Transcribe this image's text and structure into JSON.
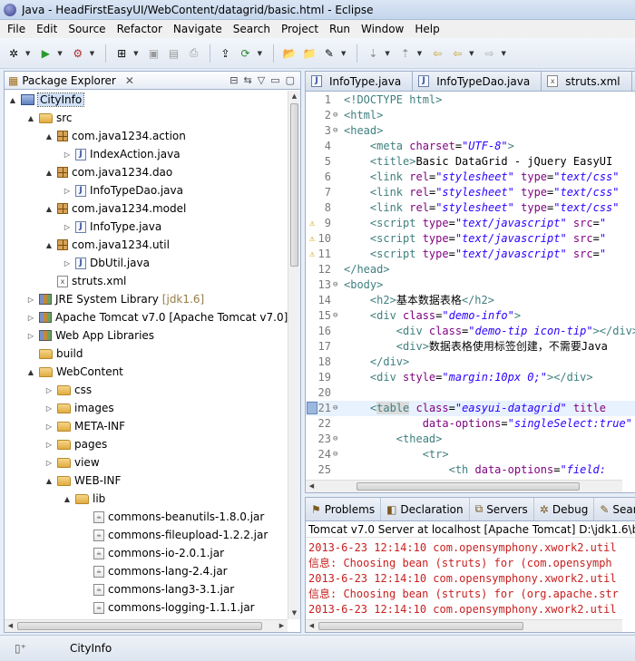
{
  "window": {
    "title": "Java - HeadFirstEasyUI/WebContent/datagrid/basic.html - Eclipse"
  },
  "menu": [
    "File",
    "Edit",
    "Source",
    "Refactor",
    "Navigate",
    "Search",
    "Project",
    "Run",
    "Window",
    "Help"
  ],
  "explorer": {
    "tab_label": "Package Explorer",
    "tree": [
      {
        "label": "CityInfo",
        "icon": "project",
        "twisty": "▲"
      },
      {
        "label": "src",
        "icon": "folder",
        "twisty": "▲"
      },
      {
        "label": "com.java1234.action",
        "icon": "pkg",
        "twisty": "▲"
      },
      {
        "label": "IndexAction.java",
        "icon": "java",
        "twisty": "▷"
      },
      {
        "label": "com.java1234.dao",
        "icon": "pkg",
        "twisty": "▲"
      },
      {
        "label": "InfoTypeDao.java",
        "icon": "java",
        "twisty": "▷"
      },
      {
        "label": "com.java1234.model",
        "icon": "pkg",
        "twisty": "▲"
      },
      {
        "label": "InfoType.java",
        "icon": "java",
        "twisty": "▷"
      },
      {
        "label": "com.java1234.util",
        "icon": "pkg",
        "twisty": "▲"
      },
      {
        "label": "DbUtil.java",
        "icon": "java",
        "twisty": "▷"
      },
      {
        "label": "struts.xml",
        "icon": "xml",
        "twisty": ""
      },
      {
        "label": "JRE System Library",
        "suffix": "[jdk1.6]",
        "icon": "lib",
        "twisty": "▷"
      },
      {
        "label": "Apache Tomcat v7.0 [Apache Tomcat v7.0]",
        "icon": "lib",
        "twisty": "▷"
      },
      {
        "label": "Web App Libraries",
        "icon": "lib",
        "twisty": "▷"
      },
      {
        "label": "build",
        "icon": "folder",
        "twisty": ""
      },
      {
        "label": "WebContent",
        "icon": "folder",
        "twisty": "▲"
      },
      {
        "label": "css",
        "icon": "folder",
        "twisty": "▷"
      },
      {
        "label": "images",
        "icon": "folder",
        "twisty": "▷"
      },
      {
        "label": "META-INF",
        "icon": "folder",
        "twisty": "▷"
      },
      {
        "label": "pages",
        "icon": "folder",
        "twisty": "▷"
      },
      {
        "label": "view",
        "icon": "folder",
        "twisty": "▷"
      },
      {
        "label": "WEB-INF",
        "icon": "folder",
        "twisty": "▲"
      },
      {
        "label": "lib",
        "icon": "folder",
        "twisty": "▲"
      },
      {
        "label": "commons-beanutils-1.8.0.jar",
        "icon": "jar",
        "twisty": ""
      },
      {
        "label": "commons-fileupload-1.2.2.jar",
        "icon": "jar",
        "twisty": ""
      },
      {
        "label": "commons-io-2.0.1.jar",
        "icon": "jar",
        "twisty": ""
      },
      {
        "label": "commons-lang-2.4.jar",
        "icon": "jar",
        "twisty": ""
      },
      {
        "label": "commons-lang3-3.1.jar",
        "icon": "jar",
        "twisty": ""
      },
      {
        "label": "commons-logging-1.1.1.jar",
        "icon": "jar",
        "twisty": ""
      }
    ]
  },
  "editor": {
    "tabs": [
      {
        "label": "InfoType.java",
        "icon": "J"
      },
      {
        "label": "InfoTypeDao.java",
        "icon": "J"
      },
      {
        "label": "struts.xml",
        "icon": "x"
      }
    ],
    "lines": [
      {
        "n": "1",
        "fold": "",
        "warn": false,
        "parts": [
          [
            "tag",
            "<!DOCTYPE html>"
          ]
        ]
      },
      {
        "n": "2",
        "fold": "⊖",
        "warn": false,
        "parts": [
          [
            "tag",
            "<html>"
          ]
        ]
      },
      {
        "n": "3",
        "fold": "⊖",
        "warn": false,
        "parts": [
          [
            "tag",
            "<head>"
          ]
        ]
      },
      {
        "n": "4",
        "fold": "",
        "warn": false,
        "parts": [
          [
            "txt",
            "    "
          ],
          [
            "tag",
            "<meta "
          ],
          [
            "attr",
            "charset"
          ],
          [
            "txt",
            "="
          ],
          [
            "str",
            "\"UTF-8\""
          ],
          [
            "tag",
            ">"
          ]
        ]
      },
      {
        "n": "5",
        "fold": "",
        "warn": false,
        "parts": [
          [
            "txt",
            "    "
          ],
          [
            "tag",
            "<title>"
          ],
          [
            "txt",
            "Basic DataGrid - jQuery EasyUI"
          ]
        ]
      },
      {
        "n": "6",
        "fold": "",
        "warn": false,
        "parts": [
          [
            "txt",
            "    "
          ],
          [
            "tag",
            "<link "
          ],
          [
            "attr",
            "rel"
          ],
          [
            "txt",
            "="
          ],
          [
            "str",
            "\"stylesheet\""
          ],
          [
            "attr",
            " type"
          ],
          [
            "txt",
            "="
          ],
          [
            "str",
            "\"text/css\""
          ]
        ]
      },
      {
        "n": "7",
        "fold": "",
        "warn": false,
        "parts": [
          [
            "txt",
            "    "
          ],
          [
            "tag",
            "<link "
          ],
          [
            "attr",
            "rel"
          ],
          [
            "txt",
            "="
          ],
          [
            "str",
            "\"stylesheet\""
          ],
          [
            "attr",
            " type"
          ],
          [
            "txt",
            "="
          ],
          [
            "str",
            "\"text/css\""
          ]
        ]
      },
      {
        "n": "8",
        "fold": "",
        "warn": false,
        "parts": [
          [
            "txt",
            "    "
          ],
          [
            "tag",
            "<link "
          ],
          [
            "attr",
            "rel"
          ],
          [
            "txt",
            "="
          ],
          [
            "str",
            "\"stylesheet\""
          ],
          [
            "attr",
            " type"
          ],
          [
            "txt",
            "="
          ],
          [
            "str",
            "\"text/css\""
          ]
        ]
      },
      {
        "n": "9",
        "fold": "",
        "warn": true,
        "parts": [
          [
            "txt",
            "    "
          ],
          [
            "tag",
            "<script "
          ],
          [
            "attr",
            "type"
          ],
          [
            "txt",
            "="
          ],
          [
            "str",
            "\"text/javascript\""
          ],
          [
            "attr",
            " src"
          ],
          [
            "txt",
            "="
          ],
          [
            "str",
            "\""
          ]
        ]
      },
      {
        "n": "10",
        "fold": "",
        "warn": true,
        "parts": [
          [
            "txt",
            "    "
          ],
          [
            "tag",
            "<script "
          ],
          [
            "attr",
            "type"
          ],
          [
            "txt",
            "="
          ],
          [
            "str",
            "\"text/javascript\""
          ],
          [
            "attr",
            " src"
          ],
          [
            "txt",
            "="
          ],
          [
            "str",
            "\""
          ]
        ]
      },
      {
        "n": "11",
        "fold": "",
        "warn": true,
        "parts": [
          [
            "txt",
            "    "
          ],
          [
            "tag",
            "<script "
          ],
          [
            "attr",
            "type"
          ],
          [
            "txt",
            "="
          ],
          [
            "str",
            "\"text/javascript\""
          ],
          [
            "attr",
            " src"
          ],
          [
            "txt",
            "="
          ],
          [
            "str",
            "\""
          ]
        ]
      },
      {
        "n": "12",
        "fold": "",
        "warn": false,
        "parts": [
          [
            "tag",
            "</head>"
          ]
        ]
      },
      {
        "n": "13",
        "fold": "⊖",
        "warn": false,
        "parts": [
          [
            "tag",
            "<body>"
          ]
        ]
      },
      {
        "n": "14",
        "fold": "",
        "warn": false,
        "parts": [
          [
            "txt",
            "    "
          ],
          [
            "tag",
            "<h2>"
          ],
          [
            "txt",
            "基本数据表格"
          ],
          [
            "tag",
            "</h2>"
          ]
        ]
      },
      {
        "n": "15",
        "fold": "⊖",
        "warn": false,
        "parts": [
          [
            "txt",
            "    "
          ],
          [
            "tag",
            "<div "
          ],
          [
            "attr",
            "class"
          ],
          [
            "txt",
            "="
          ],
          [
            "str",
            "\"demo-info\""
          ],
          [
            "tag",
            ">"
          ]
        ]
      },
      {
        "n": "16",
        "fold": "",
        "warn": false,
        "parts": [
          [
            "txt",
            "        "
          ],
          [
            "tag",
            "<div "
          ],
          [
            "attr",
            "class"
          ],
          [
            "txt",
            "="
          ],
          [
            "str",
            "\"demo-tip icon-tip\""
          ],
          [
            "tag",
            "></div>"
          ]
        ]
      },
      {
        "n": "17",
        "fold": "",
        "warn": false,
        "parts": [
          [
            "txt",
            "        "
          ],
          [
            "tag",
            "<div>"
          ],
          [
            "txt",
            "数据表格使用标签创建，不需要Java"
          ]
        ]
      },
      {
        "n": "18",
        "fold": "",
        "warn": false,
        "parts": [
          [
            "txt",
            "    "
          ],
          [
            "tag",
            "</div>"
          ]
        ]
      },
      {
        "n": "19",
        "fold": "",
        "warn": false,
        "parts": [
          [
            "txt",
            "    "
          ],
          [
            "tag",
            "<div "
          ],
          [
            "attr",
            "style"
          ],
          [
            "txt",
            "="
          ],
          [
            "str",
            "\"margin:10px 0;\""
          ],
          [
            "tag",
            "></div>"
          ]
        ]
      },
      {
        "n": "20",
        "fold": "",
        "warn": false,
        "parts": []
      },
      {
        "n": "21",
        "fold": "⊖",
        "warn": false,
        "mark": true,
        "highlight": true,
        "parts": [
          [
            "txt",
            "    "
          ],
          [
            "tag",
            "<"
          ],
          [
            "hl",
            "table"
          ],
          [
            "attr",
            " class"
          ],
          [
            "txt",
            "="
          ],
          [
            "str",
            "\"easyui-datagrid\""
          ],
          [
            "attr",
            " title"
          ]
        ]
      },
      {
        "n": "22",
        "fold": "",
        "warn": false,
        "parts": [
          [
            "txt",
            "            "
          ],
          [
            "attr",
            "data-options"
          ],
          [
            "txt",
            "="
          ],
          [
            "str",
            "\"singleSelect:true\""
          ]
        ]
      },
      {
        "n": "23",
        "fold": "⊖",
        "warn": false,
        "parts": [
          [
            "txt",
            "        "
          ],
          [
            "tag",
            "<thead>"
          ]
        ]
      },
      {
        "n": "24",
        "fold": "⊖",
        "warn": false,
        "parts": [
          [
            "txt",
            "            "
          ],
          [
            "tag",
            "<tr>"
          ]
        ]
      },
      {
        "n": "25",
        "fold": "",
        "warn": false,
        "parts": [
          [
            "txt",
            "                "
          ],
          [
            "tag",
            "<th "
          ],
          [
            "attr",
            "data-options"
          ],
          [
            "txt",
            "="
          ],
          [
            "str",
            "\"field:"
          ]
        ]
      }
    ]
  },
  "bottom": {
    "tabs": [
      {
        "label": "Problems",
        "icon": "⚑"
      },
      {
        "label": "Declaration",
        "icon": "◧"
      },
      {
        "label": "Servers",
        "icon": "⧉"
      },
      {
        "label": "Debug",
        "icon": "✲"
      },
      {
        "label": "Search",
        "icon": "✎"
      }
    ],
    "console_title": "Tomcat v7.0 Server at localhost [Apache Tomcat] D:\\jdk1.6\\bin\\",
    "console_lines": [
      "2013-6-23 12:14:10 com.opensymphony.xwork2.util",
      "信息: Choosing bean (struts) for (com.opensymph",
      "2013-6-23 12:14:10 com.opensymphony.xwork2.util",
      "信息: Choosing bean (struts) for (org.apache.str",
      "2013-6-23 12:14:10 com.opensymphony.xwork2.util"
    ]
  },
  "status": {
    "text": "CityInfo"
  }
}
